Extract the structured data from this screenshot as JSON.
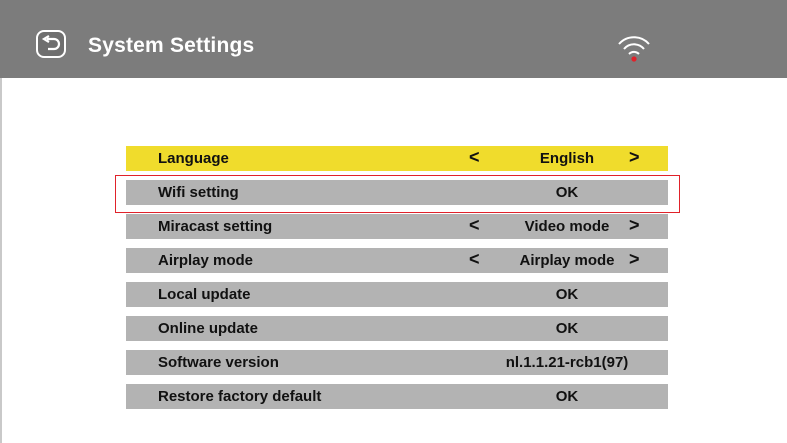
{
  "header": {
    "title": "System Settings",
    "icons": [
      "back-icon",
      "wifi-icon"
    ]
  },
  "settings": {
    "items": [
      {
        "label": "Language",
        "value": "English",
        "arrows": true,
        "active": true
      },
      {
        "label": "Wifi setting",
        "value": "OK",
        "arrows": false,
        "active": false
      },
      {
        "label": "Miracast setting",
        "value": "Video mode",
        "arrows": true,
        "active": false
      },
      {
        "label": "Airplay mode",
        "value": "Airplay mode",
        "arrows": true,
        "active": false
      },
      {
        "label": "Local update",
        "value": "OK",
        "arrows": false,
        "active": false
      },
      {
        "label": "Online update",
        "value": "OK",
        "arrows": false,
        "active": false
      },
      {
        "label": "Software version",
        "value": "nl.1.1.21-rcb1(97)",
        "arrows": false,
        "active": false
      },
      {
        "label": "Restore factory default",
        "value": "OK",
        "arrows": false,
        "active": false
      }
    ],
    "arrow_left": "<",
    "arrow_right": ">"
  },
  "colors": {
    "header": "#7c7c7c",
    "row": "#b3b3b3",
    "active_row": "#f0dc2c",
    "highlight_border": "#e0222a",
    "wifi_dot": "#e0222a"
  }
}
